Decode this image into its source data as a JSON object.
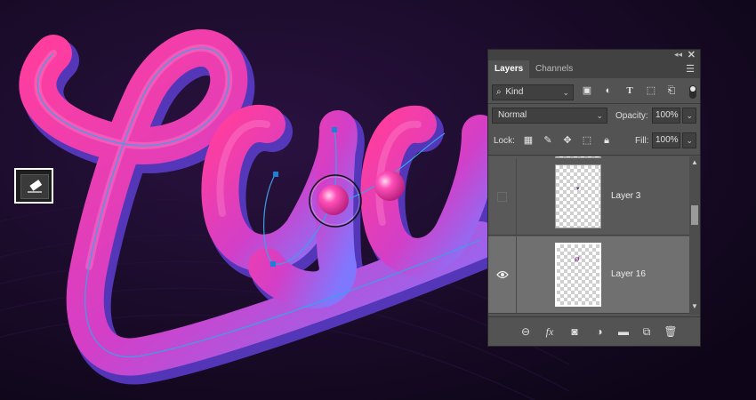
{
  "panel": {
    "tabs": [
      {
        "label": "Layers",
        "active": true
      },
      {
        "label": "Channels",
        "active": false
      }
    ],
    "collapse_icon": "double-chevron-icon",
    "close_icon": "close-icon",
    "filter": {
      "label": "Kind",
      "icon": "search-icon"
    },
    "blend_mode": "Normal",
    "opacity": {
      "label": "Opacity:",
      "value": "100%"
    },
    "lock": {
      "label": "Lock:"
    },
    "fill": {
      "label": "Fill:",
      "value": "100%"
    },
    "layers": [
      {
        "name": "Layer 3",
        "visible": false,
        "selected": false
      },
      {
        "name": "Layer 16",
        "visible": true,
        "selected": true
      }
    ],
    "footer_icons": [
      "link-icon",
      "fx-icon",
      "mask-icon",
      "adjustment-icon",
      "folder-icon",
      "new-layer-icon",
      "trash-icon"
    ],
    "fx_label": "fx"
  },
  "toolbar": {
    "active_tool_icon": "eraser-icon"
  },
  "colors": {
    "background": "#12081e",
    "tube_pink": "#e8308f",
    "tube_violet": "#8d6bff",
    "path_line": "#3aa0e8",
    "panel": "#535353",
    "selected_row": "#707070"
  }
}
